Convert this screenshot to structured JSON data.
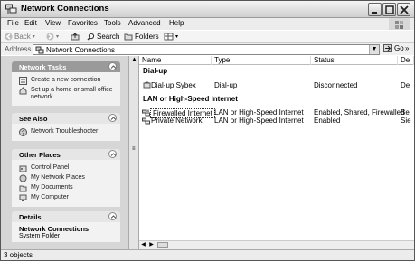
{
  "window": {
    "title": "Network Connections"
  },
  "menu": [
    "File",
    "Edit",
    "View",
    "Favorites",
    "Tools",
    "Advanced",
    "Help"
  ],
  "toolbar": {
    "back_label": "Back",
    "search_label": "Search",
    "folders_label": "Folders"
  },
  "address": {
    "label": "Address",
    "value": "Network Connections",
    "go_label": "Go"
  },
  "tasks_pane": {
    "network_tasks": {
      "title": "Network Tasks",
      "items": [
        "Create a new connection",
        "Set up a home or small office network"
      ]
    },
    "see_also": {
      "title": "See Also",
      "items": [
        "Network Troubleshooter"
      ]
    },
    "other_places": {
      "title": "Other Places",
      "items": [
        "Control Panel",
        "My Network Places",
        "My Documents",
        "My Computer"
      ]
    },
    "details": {
      "title": "Details",
      "name": "Network Connections",
      "type": "System Folder"
    }
  },
  "list": {
    "columns": [
      "Name",
      "Type",
      "Status",
      "De"
    ],
    "groups": [
      {
        "title": "Dial-up",
        "rows": [
          {
            "name": "Dial-up Sybex",
            "type": "Dial-up",
            "status": "Disconnected",
            "device": "De"
          }
        ]
      },
      {
        "title": "LAN or High-Speed Internet",
        "rows": [
          {
            "name": "Firewalled Internet",
            "type": "LAN or High-Speed Internet",
            "status": "Enabled, Shared, Firewalled",
            "device": "Bel"
          },
          {
            "name": "Private Network",
            "type": "LAN or High-Speed Internet",
            "status": "Enabled",
            "device": "Sie"
          }
        ]
      }
    ]
  },
  "statusbar": {
    "text": "3 objects"
  },
  "colors": {
    "pane_bg": "#d6d6d6",
    "panel_head": "#9a9a9a",
    "window_bg": "#ffffff"
  }
}
